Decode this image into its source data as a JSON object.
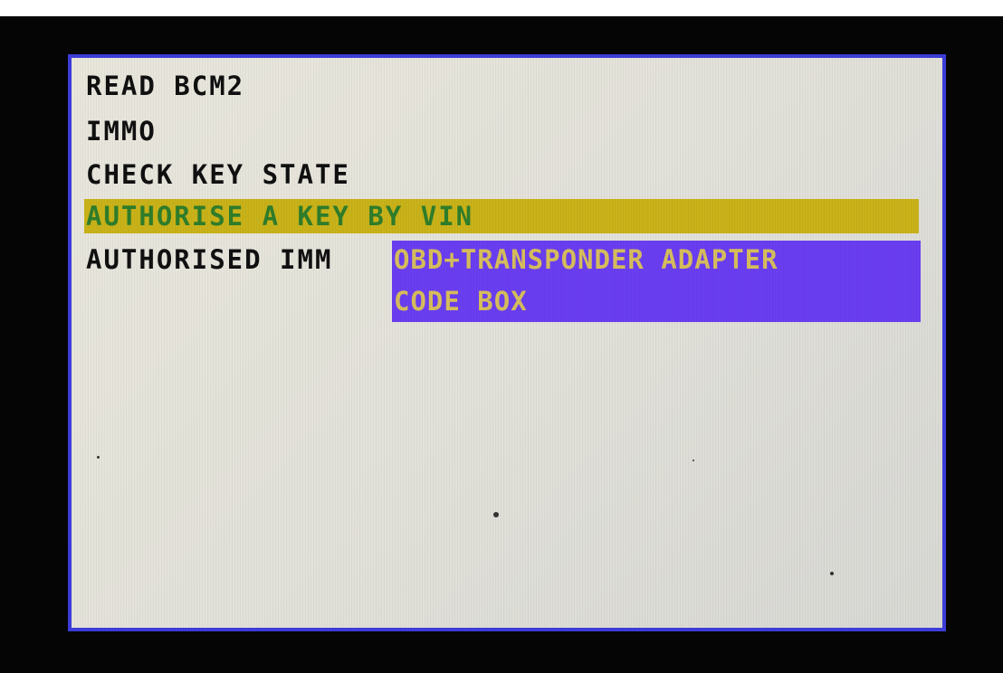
{
  "menu": {
    "items": [
      {
        "label": "READ BCM2"
      },
      {
        "label": "IMMO"
      },
      {
        "label": "CHECK KEY STATE"
      },
      {
        "label": "AUTHORISE A KEY BY VIN"
      },
      {
        "label": "AUTHORISED IMM"
      }
    ],
    "selected_index": 3
  },
  "popup": {
    "options": [
      {
        "label": "OBD+TRANSPONDER ADAPTER"
      },
      {
        "label": "CODE BOX"
      }
    ]
  },
  "colors": {
    "screen_border": "#3c3cd8",
    "selection_bg": "#c9b219",
    "selection_text": "#2f7d2a",
    "popup_bg": "#6a3ef0",
    "popup_text": "#d7be5c"
  }
}
